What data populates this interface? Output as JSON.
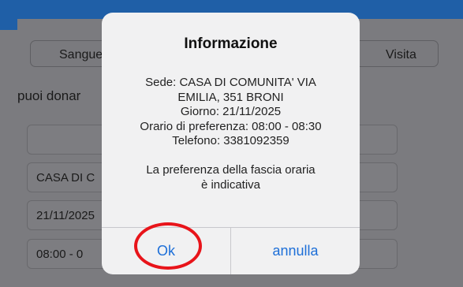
{
  "background": {
    "segment_left_label": "Sangue",
    "segment_right_label": "Visita",
    "info_text": "puoi donar",
    "field_place": "CASA DI C",
    "field_date": "21/11/2025",
    "field_time": "08:00 - 0"
  },
  "dialog": {
    "title": "Informazione",
    "message_lines": [
      "Sede: CASA DI COMUNITA'  VIA",
      "EMILIA, 351 BRONI",
      "Giorno: 21/11/2025",
      "Orario di preferenza: 08:00 - 08:30",
      "Telefono: 3381092359",
      "",
      "La preferenza della fascia oraria",
      "è indicativa"
    ],
    "ok_label": "Ok",
    "cancel_label": "annulla"
  },
  "colors": {
    "topbar": "#1f5fa7",
    "button_text": "#1d6fd8",
    "highlight_ring": "#e8141a"
  }
}
